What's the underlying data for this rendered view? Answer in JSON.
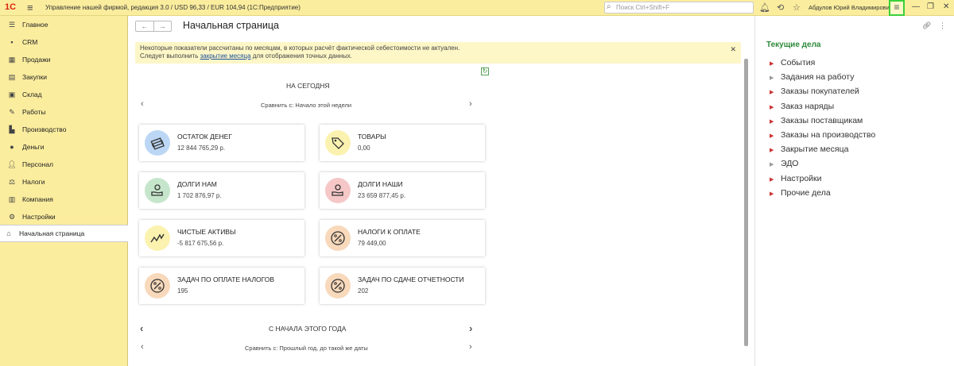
{
  "titlebar": {
    "logo": "1С",
    "app_title": "Управление нашей фирмой, редакция 3.0 / USD 96,33 / EUR 104,94  (1С:Предприятие)",
    "search_placeholder": "Поиск Ctrl+Shift+F",
    "user": "Абдулов Юрий Владимирович"
  },
  "sidebar": {
    "items": [
      {
        "label": "Главное",
        "icon": "menu-icon"
      },
      {
        "label": "CRM",
        "icon": "crm-icon"
      },
      {
        "label": "Продажи",
        "icon": "sales-icon"
      },
      {
        "label": "Закупки",
        "icon": "purchases-icon"
      },
      {
        "label": "Склад",
        "icon": "warehouse-icon"
      },
      {
        "label": "Работы",
        "icon": "work-icon"
      },
      {
        "label": "Производство",
        "icon": "factory-icon"
      },
      {
        "label": "Деньги",
        "icon": "money-icon"
      },
      {
        "label": "Персонал",
        "icon": "person-icon"
      },
      {
        "label": "Налоги",
        "icon": "tax-icon"
      },
      {
        "label": "Компания",
        "icon": "company-icon"
      },
      {
        "label": "Настройки",
        "icon": "gear-icon"
      },
      {
        "label": "Начальная страница",
        "icon": "home-icon"
      }
    ]
  },
  "main": {
    "page_title": "Начальная страница",
    "warning_line1": "Некоторые показатели рассчитаны по месяцам, в которых расчёт фактической себестоимости не актуален.",
    "warning_line2_pre": "Следует выполнить ",
    "warning_link": "закрытие месяца",
    "warning_line2_post": " для отображения точных данных.",
    "section_today": "НА СЕГОДНЯ",
    "compare_today": "Сравнить с: Начало этой недели",
    "section_year": "С НАЧАЛА ЭТОГО ГОДА",
    "compare_year": "Сравнить с: Прошлый год, до такой же даты",
    "cards": [
      {
        "title": "ОСТАТОК ДЕНЕГ",
        "value": "12 844 765,29 р.",
        "color": "#bcd7f5"
      },
      {
        "title": "ТОВАРЫ",
        "value": "0,00",
        "color": "#fbf2b0"
      },
      {
        "title": "ДОЛГИ НАМ",
        "value": "1 702 876,97 р.",
        "color": "#c6e6cc"
      },
      {
        "title": "ДОЛГИ НАШИ",
        "value": "23 659 877,45 р.",
        "color": "#f6c7c7"
      },
      {
        "title": "ЧИСТЫЕ АКТИВЫ",
        "value": "-5 817 675,56 р.",
        "color": "#fbf2b0"
      },
      {
        "title": "НАЛОГИ К ОПЛАТЕ",
        "value": "79 449,00",
        "color": "#f8d9bb"
      },
      {
        "title": "ЗАДАЧ ПО ОПЛАТЕ НАЛОГОВ",
        "value": "195",
        "color": "#f8d9bb"
      },
      {
        "title": "ЗАДАЧ ПО СДАЧЕ ОТЧЕТНОСТИ",
        "value": "202",
        "color": "#f8d9bb"
      }
    ]
  },
  "right": {
    "title": "Текущие дела",
    "items": [
      {
        "label": "События",
        "state": "red"
      },
      {
        "label": "Задания на работу",
        "state": "grey"
      },
      {
        "label": "Заказы покупателей",
        "state": "red"
      },
      {
        "label": "Заказ наряды",
        "state": "red"
      },
      {
        "label": "Заказы поставщикам",
        "state": "red"
      },
      {
        "label": "Заказы на производство",
        "state": "red"
      },
      {
        "label": "Закрытие месяца",
        "state": "red"
      },
      {
        "label": "ЭДО",
        "state": "grey"
      },
      {
        "label": "Настройки",
        "state": "red"
      },
      {
        "label": "Прочие дела",
        "state": "red"
      }
    ]
  }
}
